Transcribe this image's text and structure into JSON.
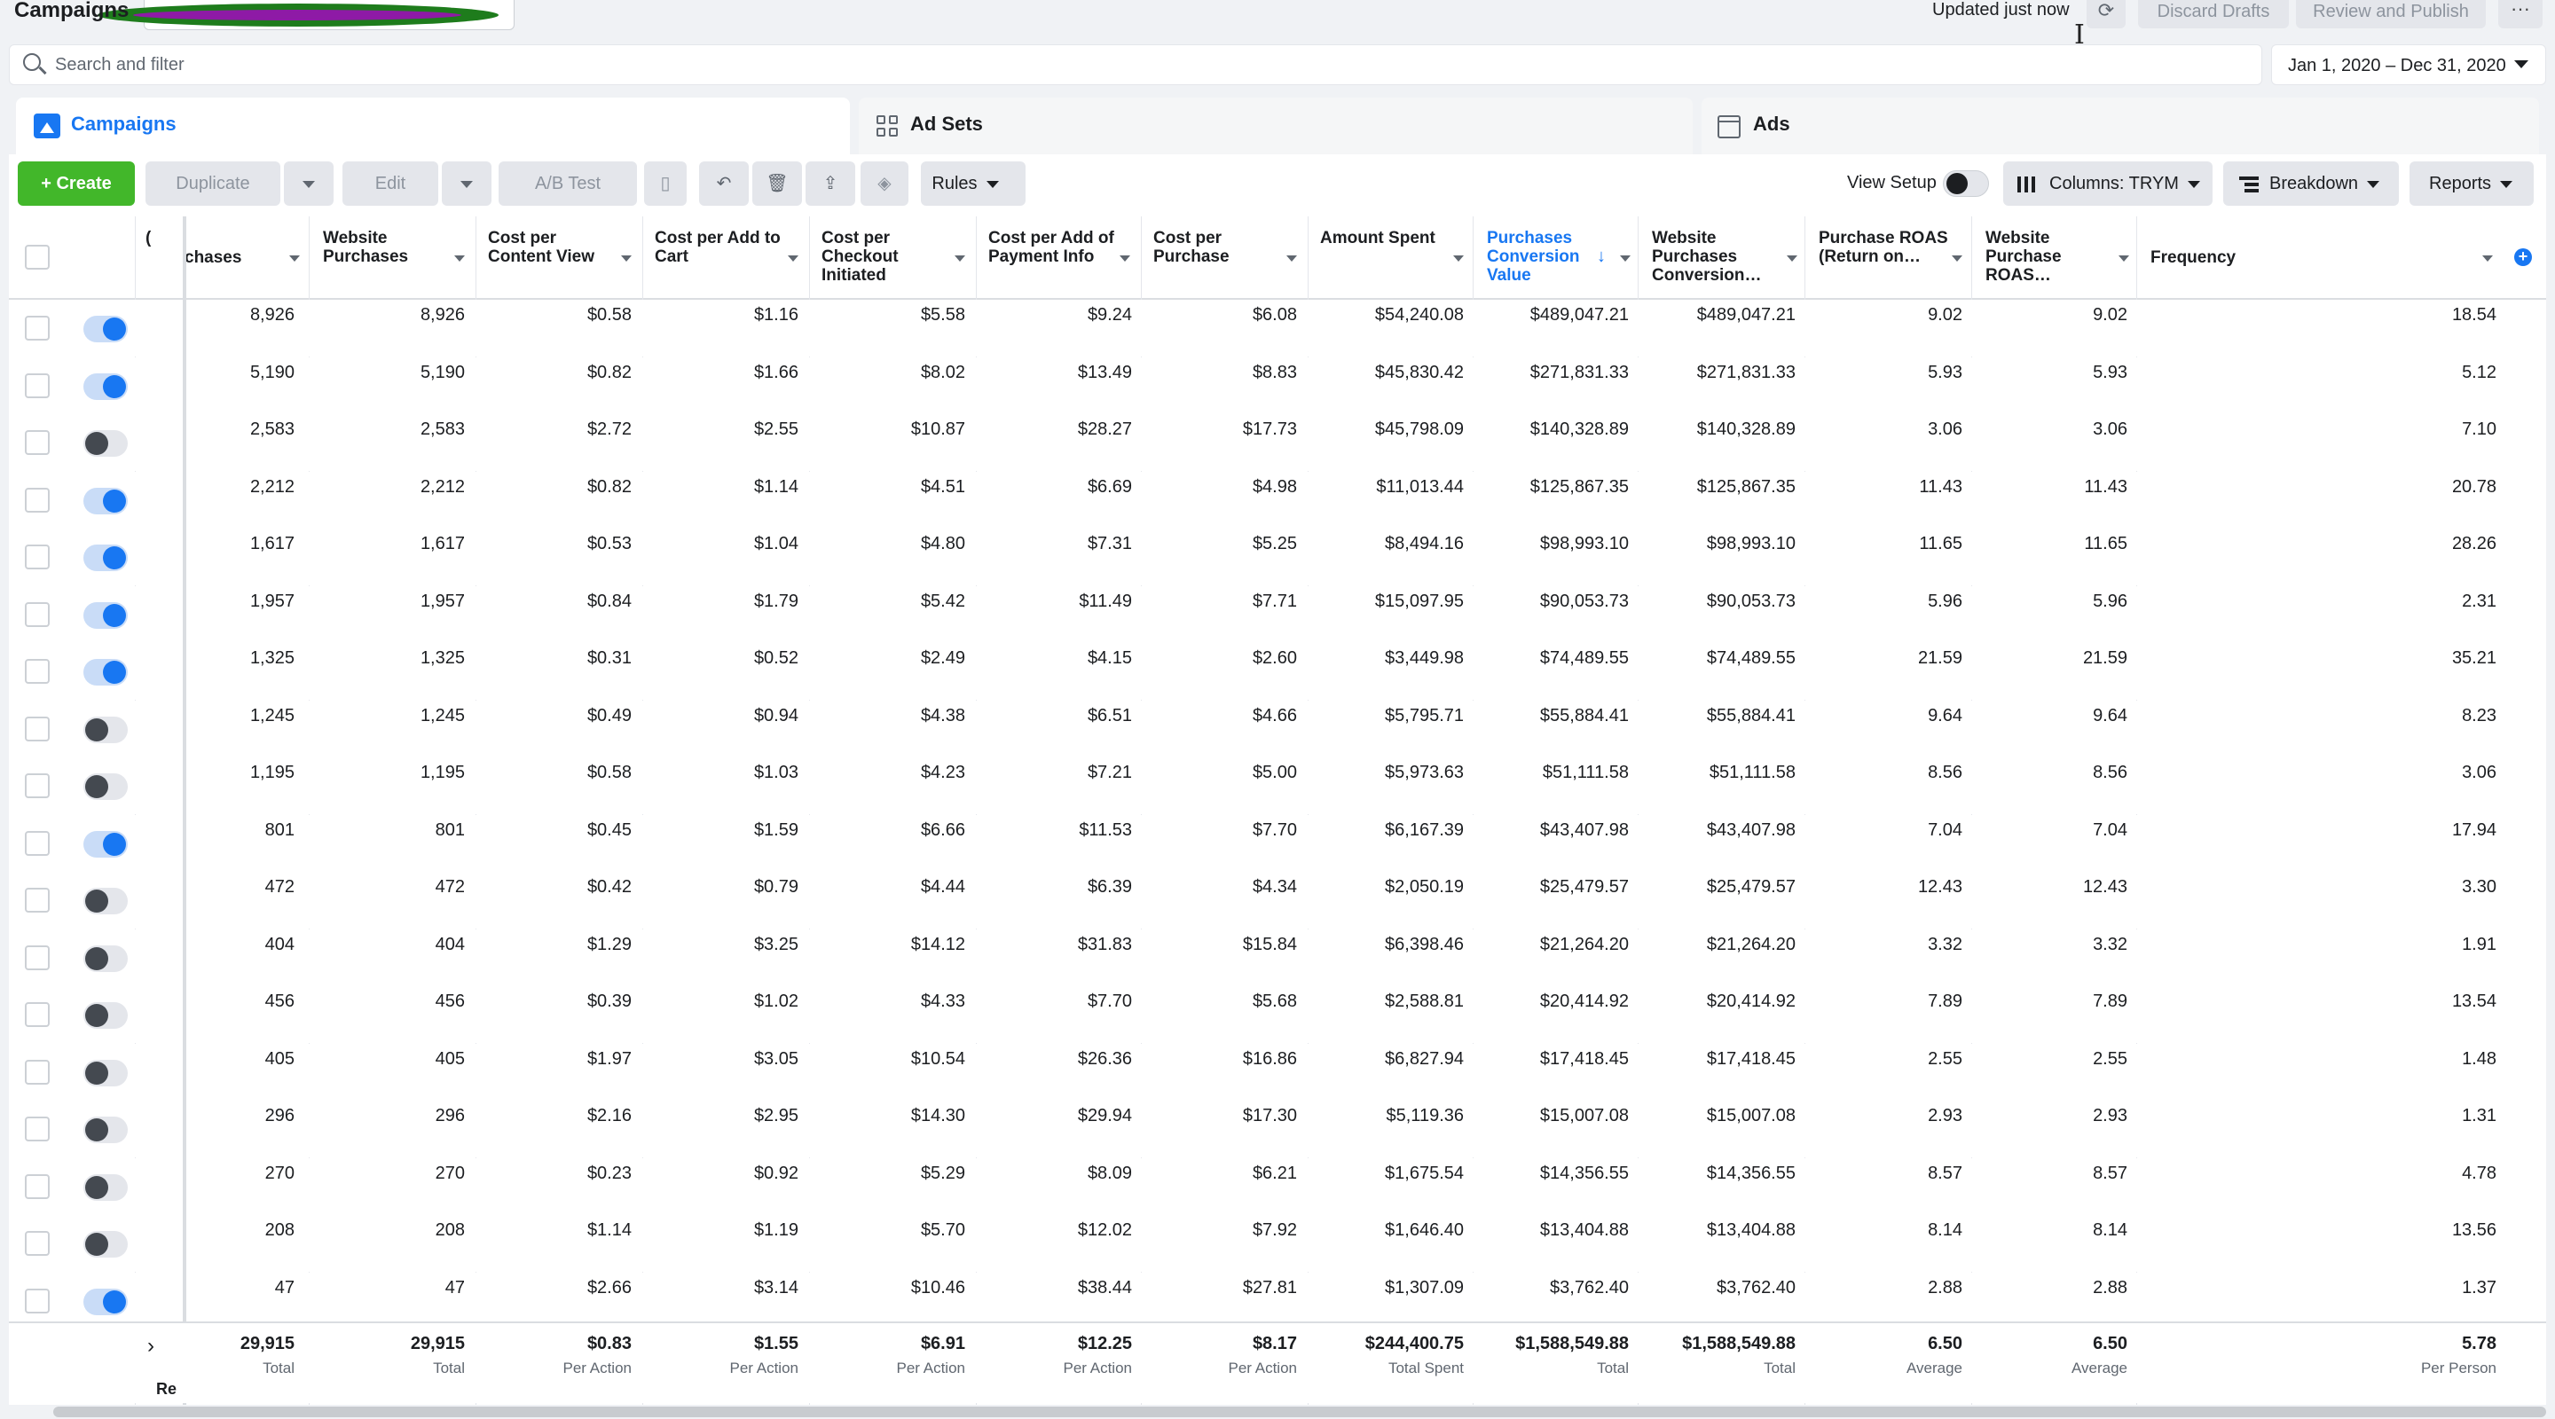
{
  "header": {
    "title": "Campaigns",
    "updated": "Updated just now",
    "discard_label": "Discard Drafts",
    "publish_label": "Review and Publish",
    "more_label": "···"
  },
  "search": {
    "placeholder": "Search and filter",
    "date_range": "Jan 1, 2020 – Dec 31, 2020"
  },
  "level_tabs": [
    {
      "label": "Campaigns",
      "icon": "campaigns-icon",
      "active": true
    },
    {
      "label": "Ad Sets",
      "icon": "adsets-grid-icon",
      "active": false
    },
    {
      "label": "Ads",
      "icon": "ads-window-icon",
      "active": false
    }
  ],
  "toolbar": {
    "create": "+ Create",
    "duplicate": "Duplicate",
    "edit": "Edit",
    "abtest": "A/B Test",
    "rules": "Rules",
    "view_setup": "View Setup",
    "columns": "Columns: TRYM",
    "breakdown": "Breakdown",
    "reports": "Reports"
  },
  "table": {
    "columns": [
      "chases",
      "Website Purchases",
      "Cost per Content View",
      "Cost per Add to Cart",
      "Cost per Checkout Initiated",
      "Cost per Add of Payment Info",
      "Cost per Purchase",
      "Amount Spent",
      "Purchases Conversion Value",
      "Website Purchases Conversion…",
      "Purchase ROAS (Return on…",
      "Website Purchase ROAS…",
      "Frequency"
    ],
    "sorted_column": "Purchases Conversion Value",
    "rows": [
      {
        "on": true,
        "cells": [
          "8,926",
          "8,926",
          "$0.58",
          "$1.16",
          "$5.58",
          "$9.24",
          "$6.08",
          "$54,240.08",
          "$489,047.21",
          "$489,047.21",
          "9.02",
          "9.02",
          "18.54"
        ]
      },
      {
        "on": true,
        "cells": [
          "5,190",
          "5,190",
          "$0.82",
          "$1.66",
          "$8.02",
          "$13.49",
          "$8.83",
          "$45,830.42",
          "$271,831.33",
          "$271,831.33",
          "5.93",
          "5.93",
          "5.12"
        ]
      },
      {
        "on": false,
        "cells": [
          "2,583",
          "2,583",
          "$2.72",
          "$2.55",
          "$10.87",
          "$28.27",
          "$17.73",
          "$45,798.09",
          "$140,328.89",
          "$140,328.89",
          "3.06",
          "3.06",
          "7.10"
        ]
      },
      {
        "on": true,
        "cells": [
          "2,212",
          "2,212",
          "$0.82",
          "$1.14",
          "$4.51",
          "$6.69",
          "$4.98",
          "$11,013.44",
          "$125,867.35",
          "$125,867.35",
          "11.43",
          "11.43",
          "20.78"
        ]
      },
      {
        "on": true,
        "cells": [
          "1,617",
          "1,617",
          "$0.53",
          "$1.04",
          "$4.80",
          "$7.31",
          "$5.25",
          "$8,494.16",
          "$98,993.10",
          "$98,993.10",
          "11.65",
          "11.65",
          "28.26"
        ]
      },
      {
        "on": true,
        "cells": [
          "1,957",
          "1,957",
          "$0.84",
          "$1.79",
          "$5.42",
          "$11.49",
          "$7.71",
          "$15,097.95",
          "$90,053.73",
          "$90,053.73",
          "5.96",
          "5.96",
          "2.31"
        ]
      },
      {
        "on": true,
        "cells": [
          "1,325",
          "1,325",
          "$0.31",
          "$0.52",
          "$2.49",
          "$4.15",
          "$2.60",
          "$3,449.98",
          "$74,489.55",
          "$74,489.55",
          "21.59",
          "21.59",
          "35.21"
        ]
      },
      {
        "on": false,
        "cells": [
          "1,245",
          "1,245",
          "$0.49",
          "$0.94",
          "$4.38",
          "$6.51",
          "$4.66",
          "$5,795.71",
          "$55,884.41",
          "$55,884.41",
          "9.64",
          "9.64",
          "8.23"
        ]
      },
      {
        "on": false,
        "cells": [
          "1,195",
          "1,195",
          "$0.58",
          "$1.03",
          "$4.23",
          "$7.21",
          "$5.00",
          "$5,973.63",
          "$51,111.58",
          "$51,111.58",
          "8.56",
          "8.56",
          "3.06"
        ]
      },
      {
        "on": true,
        "cells": [
          "801",
          "801",
          "$0.45",
          "$1.59",
          "$6.66",
          "$11.53",
          "$7.70",
          "$6,167.39",
          "$43,407.98",
          "$43,407.98",
          "7.04",
          "7.04",
          "17.94"
        ]
      },
      {
        "on": false,
        "cells": [
          "472",
          "472",
          "$0.42",
          "$0.79",
          "$4.44",
          "$6.39",
          "$4.34",
          "$2,050.19",
          "$25,479.57",
          "$25,479.57",
          "12.43",
          "12.43",
          "3.30"
        ]
      },
      {
        "on": false,
        "cells": [
          "404",
          "404",
          "$1.29",
          "$3.25",
          "$14.12",
          "$31.83",
          "$15.84",
          "$6,398.46",
          "$21,264.20",
          "$21,264.20",
          "3.32",
          "3.32",
          "1.91"
        ]
      },
      {
        "on": false,
        "cells": [
          "456",
          "456",
          "$0.39",
          "$1.02",
          "$4.33",
          "$7.70",
          "$5.68",
          "$2,588.81",
          "$20,414.92",
          "$20,414.92",
          "7.89",
          "7.89",
          "13.54"
        ]
      },
      {
        "on": false,
        "cells": [
          "405",
          "405",
          "$1.97",
          "$3.05",
          "$10.54",
          "$26.36",
          "$16.86",
          "$6,827.94",
          "$17,418.45",
          "$17,418.45",
          "2.55",
          "2.55",
          "1.48"
        ]
      },
      {
        "on": false,
        "cells": [
          "296",
          "296",
          "$2.16",
          "$2.95",
          "$14.30",
          "$29.94",
          "$17.30",
          "$5,119.36",
          "$15,007.08",
          "$15,007.08",
          "2.93",
          "2.93",
          "1.31"
        ]
      },
      {
        "on": false,
        "cells": [
          "270",
          "270",
          "$0.23",
          "$0.92",
          "$5.29",
          "$8.09",
          "$6.21",
          "$1,675.54",
          "$14,356.55",
          "$14,356.55",
          "8.57",
          "8.57",
          "4.78"
        ]
      },
      {
        "on": false,
        "cells": [
          "208",
          "208",
          "$1.14",
          "$1.19",
          "$5.70",
          "$12.02",
          "$7.92",
          "$1,646.40",
          "$13,404.88",
          "$13,404.88",
          "8.14",
          "8.14",
          "13.56"
        ]
      },
      {
        "on": true,
        "cells": [
          "47",
          "47",
          "$2.66",
          "$3.14",
          "$10.46",
          "$38.44",
          "$27.81",
          "$1,307.09",
          "$3,762.40",
          "$3,762.40",
          "2.88",
          "2.88",
          "1.37"
        ]
      }
    ],
    "totals": {
      "name": "Re",
      "values": [
        "29,915",
        "29,915",
        "$0.83",
        "$1.55",
        "$6.91",
        "$12.25",
        "$8.17",
        "$244,400.75",
        "$1,588,549.88",
        "$1,588,549.88",
        "6.50",
        "6.50",
        "5.78"
      ],
      "labels": [
        "Total",
        "Total",
        "Per Action",
        "Per Action",
        "Per Action",
        "Per Action",
        "Per Action",
        "Total Spent",
        "Total",
        "Total",
        "Average",
        "Average",
        "Per Person"
      ]
    }
  }
}
